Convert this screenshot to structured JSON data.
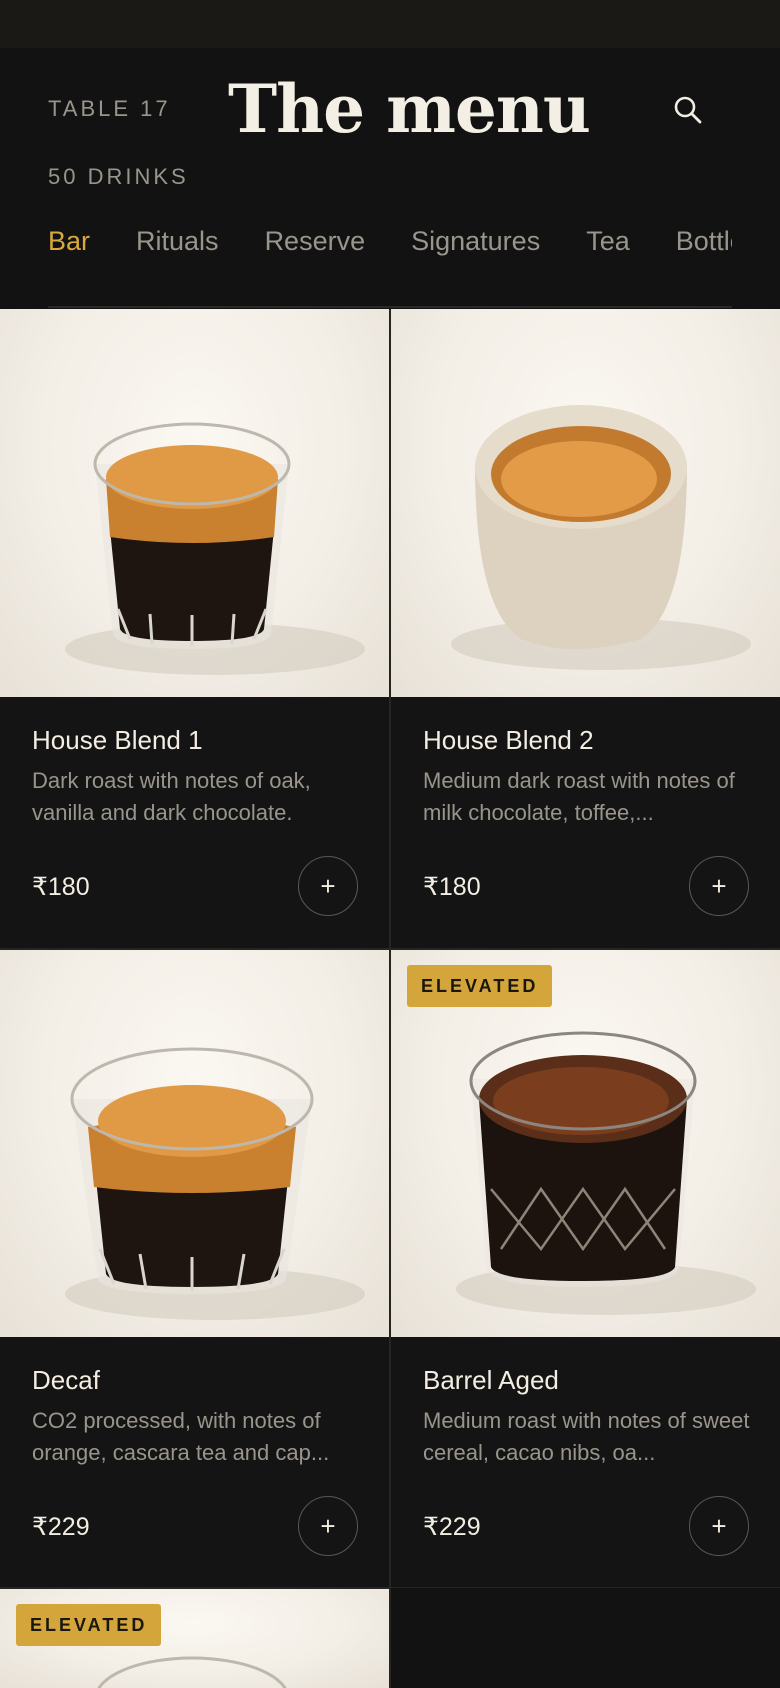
{
  "header": {
    "table_label": "TABLE 17",
    "title": "The menu",
    "count_label": "50 DRINKS"
  },
  "tabs": [
    {
      "label": "Bar",
      "active": true
    },
    {
      "label": "Rituals"
    },
    {
      "label": "Reserve"
    },
    {
      "label": "Signatures"
    },
    {
      "label": "Tea"
    },
    {
      "label": "Bottles"
    }
  ],
  "items": [
    {
      "name": "House Blend 1",
      "description": "Dark roast with notes of oak, vanilla and dark chocolate.",
      "price": "₹180",
      "add_label": "+",
      "badge": ""
    },
    {
      "name": "House Blend 2",
      "description": "Medium dark roast with notes of milk chocolate, toffee,...",
      "price": "₹180",
      "add_label": "+",
      "badge": ""
    },
    {
      "name": "Decaf",
      "description": "CO2 processed, with notes of orange, cascara tea and cap...",
      "price": "₹229",
      "add_label": "+",
      "badge": ""
    },
    {
      "name": "Barrel Aged",
      "description": "Medium roast with notes of sweet cereal, cacao nibs, oa...",
      "price": "₹229",
      "add_label": "+",
      "badge": "ELEVATED"
    },
    {
      "badge": "ELEVATED"
    }
  ],
  "colors": {
    "background": "#121212",
    "accent": "#d8a93c",
    "badge": "#d3a53a",
    "muted_text": "#9a958c"
  },
  "icons": {
    "search": "search-icon",
    "add": "plus-icon"
  }
}
